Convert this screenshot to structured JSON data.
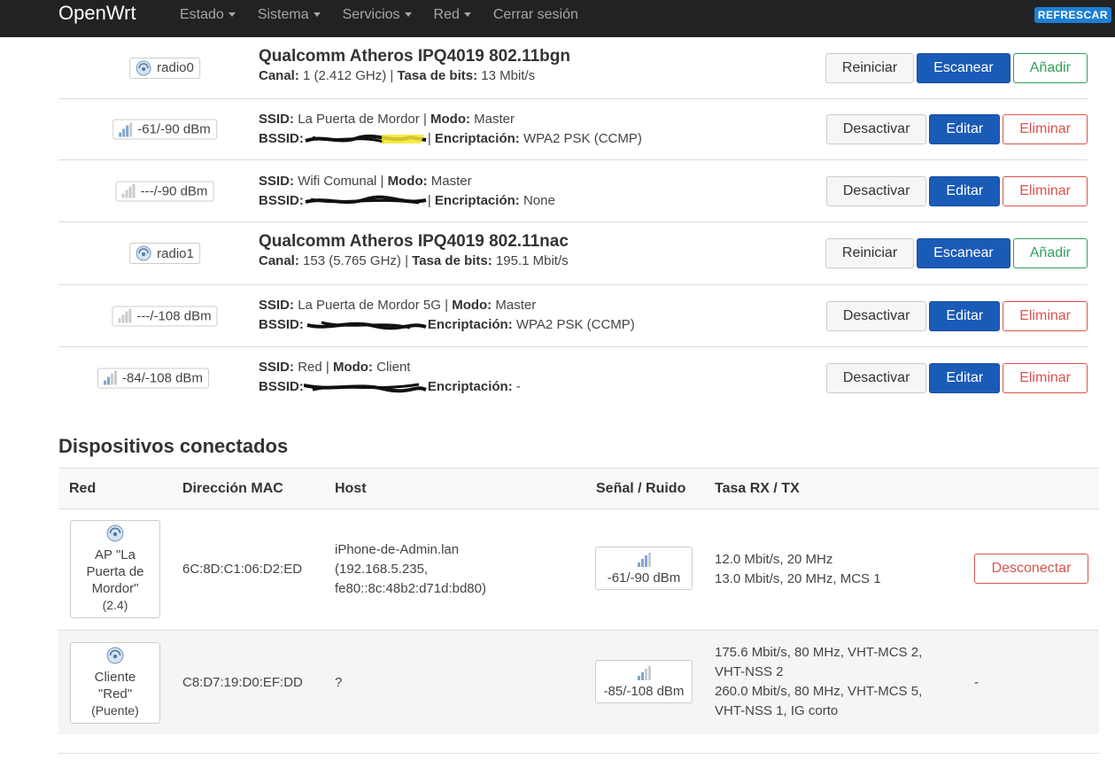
{
  "header": {
    "brand": "OpenWrt",
    "menu": [
      {
        "label": "Estado",
        "dropdown": true
      },
      {
        "label": "Sistema",
        "dropdown": true
      },
      {
        "label": "Servicios",
        "dropdown": true
      },
      {
        "label": "Red",
        "dropdown": true
      },
      {
        "label": "Cerrar sesión",
        "dropdown": false
      }
    ],
    "refresh_label": "REFRESCAR"
  },
  "labels": {
    "canal": "Canal:",
    "tasa": "Tasa de bits:",
    "ssid": "SSID:",
    "modo": "Modo:",
    "bssid": "BSSID:",
    "encriptacion": "Encriptación:",
    "sep": "|"
  },
  "radios": [
    {
      "badge": "radio0",
      "title": "Qualcomm Atheros IPQ4019 802.11bgn",
      "canal": "1 (2.412 GHz)",
      "tasa": "13 Mbit/s",
      "buttons": {
        "reiniciar": "Reiniciar",
        "escanear": "Escanear",
        "anadir": "Añadir"
      },
      "networks": [
        {
          "signal": "-61/-90 dBm",
          "signal_level": 3,
          "ssid": "La Puerta de Mordor",
          "modo": "Master",
          "encriptacion": "WPA2 PSK (CCMP)"
        },
        {
          "signal": "---/-90 dBm",
          "signal_level": 0,
          "ssid": "Wifi Comunal",
          "modo": "Master",
          "encriptacion": "None"
        }
      ]
    },
    {
      "badge": "radio1",
      "title": "Qualcomm Atheros IPQ4019 802.11nac",
      "canal": "153 (5.765 GHz)",
      "tasa": "195.1 Mbit/s",
      "buttons": {
        "reiniciar": "Reiniciar",
        "escanear": "Escanear",
        "anadir": "Añadir"
      },
      "networks": [
        {
          "signal": "---/-108 dBm",
          "signal_level": 0,
          "ssid": "La Puerta de Mordor 5G",
          "modo": "Master",
          "encriptacion": "WPA2 PSK (CCMP)"
        },
        {
          "signal": "-84/-108 dBm",
          "signal_level": 2,
          "ssid": "Red",
          "modo": "Client",
          "encriptacion": "-"
        }
      ]
    }
  ],
  "network_buttons": {
    "desactivar": "Desactivar",
    "editar": "Editar",
    "eliminar": "Eliminar"
  },
  "devices": {
    "title": "Dispositivos conectados",
    "columns": [
      "Red",
      "Dirección MAC",
      "Host",
      "Señal / Ruido",
      "Tasa RX / TX"
    ],
    "rows": [
      {
        "net_lines": [
          "AP \"La",
          "Puerta de",
          "Mordor\""
        ],
        "net_sub": "(2.4)",
        "mac": "6C:8D:C1:06:D2:ED",
        "host": [
          "iPhone-de-Admin.lan",
          "(192.168.5.235,",
          "fe80::8c:48b2:d71d:bd80)"
        ],
        "signal": "-61/-90 dBm",
        "signal_level": 3,
        "rate": [
          "12.0 Mbit/s, 20 MHz",
          "13.0 Mbit/s, 20 MHz, MCS 1"
        ],
        "action": "Desconectar"
      },
      {
        "net_lines": [
          "Cliente",
          "\"Red\""
        ],
        "net_sub": "(Puente)",
        "mac": "C8:D7:19:D0:EF:DD",
        "host": [
          "?"
        ],
        "signal": "-85/-108 dBm",
        "signal_level": 2,
        "rate": [
          "175.6 Mbit/s, 80 MHz, VHT-MCS 2,",
          "VHT-NSS 2",
          "260.0 Mbit/s, 80 MHz, VHT-MCS 5,",
          "VHT-NSS 1, IG corto"
        ],
        "action": "-"
      }
    ]
  },
  "colors": {
    "topbar": "#222222",
    "primary": "#1a5bb8",
    "success": "#2fa05a",
    "danger": "#d9534f",
    "refresh": "#1c7fd4"
  }
}
